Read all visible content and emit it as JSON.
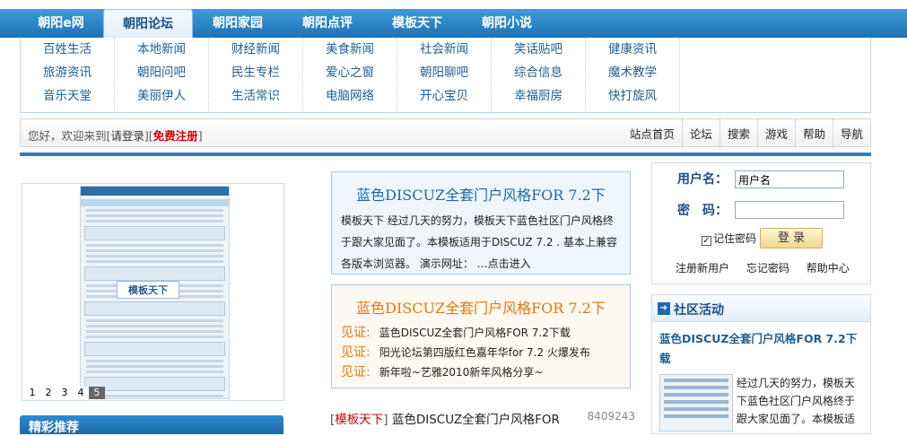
{
  "nav": {
    "tabs": [
      "朝阳e网",
      "朝阳论坛",
      "朝阳家园",
      "朝阳点评",
      "模板天下",
      "朝阳小说"
    ],
    "active_index": 1
  },
  "subnav": {
    "columns": [
      [
        "百姓生活",
        "旅游资讯",
        "音乐天堂"
      ],
      [
        "本地新闻",
        "朝阳问吧",
        "美丽伊人"
      ],
      [
        "财经新闻",
        "民生专栏",
        "生活常识"
      ],
      [
        "美食新闻",
        "爱心之窗",
        "电脑网络"
      ],
      [
        "社会新闻",
        "朝阳聊吧",
        "开心宝贝"
      ],
      [
        "笑话贴吧",
        "综合信息",
        "幸福厨房"
      ],
      [
        "健康资讯",
        "魔术教学",
        "快打旋风"
      ]
    ]
  },
  "welcome": {
    "prefix": "您好，欢迎来到[",
    "login": "请登录",
    "mid": "][",
    "register": "免费注册",
    "suffix": "]"
  },
  "quicklinks": [
    "站点首页",
    "论坛",
    "搜索",
    "游戏",
    "帮助",
    "导航"
  ],
  "slideshow": {
    "numbers": [
      "1",
      "2",
      "3",
      "4",
      "5"
    ],
    "active": 4,
    "logo_text": "模板天下"
  },
  "featured": {
    "title": "精彩推荐"
  },
  "box1": {
    "title": "蓝色DISCUZ全套门户风格FOR 7.2下",
    "body": "模板天下 经过几天的努力，模板天下蓝色社区门户风格终于跟大家见面了。本模板适用于DISCUZ 7.2 . 基本上兼容各版本浏览器。 演示网址： …点击进入"
  },
  "box2": {
    "title": "蓝色DISCUZ全套门户风格FOR 7.2下",
    "items": [
      {
        "tag": "见证:",
        "text": "蓝色DISCUZ全套门户风格FOR 7.2下载"
      },
      {
        "tag": "见证:",
        "text": "阳光论坛第四版红色嘉年华for 7.2 火爆发布"
      },
      {
        "tag": "见证:",
        "text": "新年啦~艺雅2010新年风格分享~"
      }
    ]
  },
  "news": {
    "open": "[",
    "tag": "模板天下",
    "close": "]",
    "text": "蓝色DISCUZ全套门户风格FOR",
    "number": "8409243"
  },
  "login": {
    "username_label": "用户名：",
    "password_label": "密　码：",
    "username_value": "用户名",
    "remember": "记住密码",
    "button": "登 录",
    "links": [
      "注册新用户",
      "忘记密码",
      "帮助中心"
    ]
  },
  "community": {
    "header": "社区活动",
    "title": "蓝色DISCUZ全套门户风格FOR 7.2下载",
    "desc": "经过几天的努力，模板天下蓝色社区门户风格终于跟大家见面了。本模板适"
  }
}
